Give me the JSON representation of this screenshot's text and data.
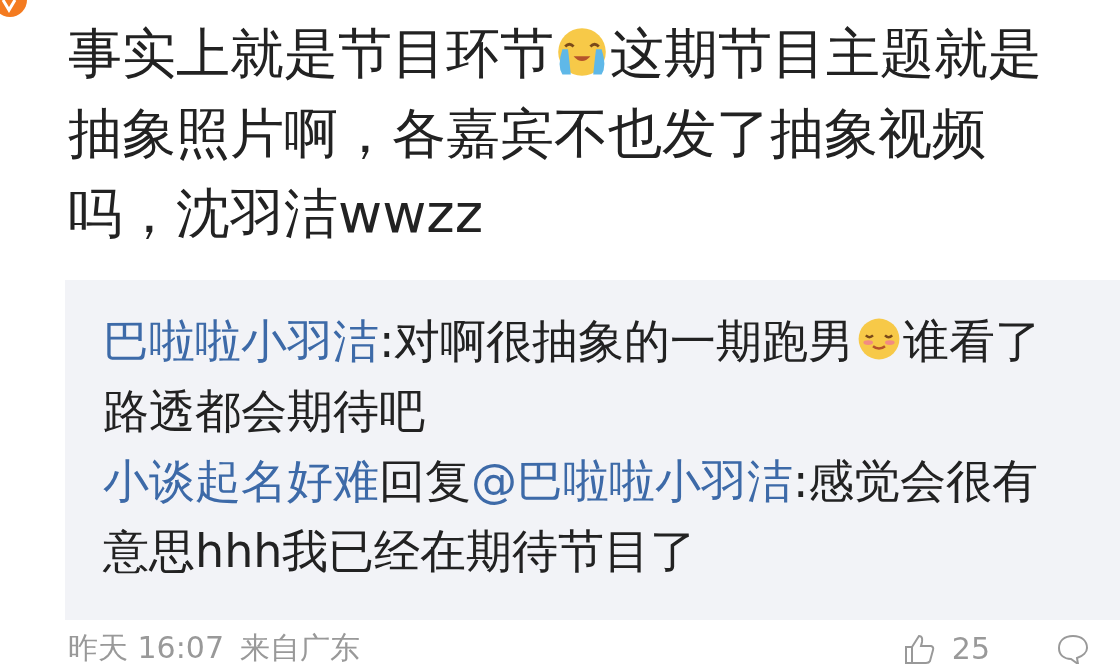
{
  "comment": {
    "body": [
      {
        "kind": "text",
        "text": "事实上就是节目环节"
      },
      {
        "kind": "crying_emoji"
      },
      {
        "kind": "text",
        "text": "这期节目主题就是抽象照片啊，各嘉宾不也发了抽象视频吗，沈羽洁wwzz"
      }
    ]
  },
  "replies": [
    {
      "user": "巴啦啦小羽洁",
      "body": [
        {
          "kind": "text",
          "text": ":对啊很抽象的一期跑男"
        },
        {
          "kind": "smile_emoji"
        },
        {
          "kind": "text",
          "text": "谁看了路透都会期待吧"
        }
      ]
    },
    {
      "user": "小谈起名好难",
      "body": [
        {
          "kind": "text",
          "text": "回复"
        },
        {
          "kind": "mention",
          "text": "@巴啦啦小羽洁"
        },
        {
          "kind": "text",
          "text": ":感觉会很有意思hhh我已经在期待节目了"
        }
      ]
    }
  ],
  "footer": {
    "time": "昨天 16:07",
    "source": "来自广东",
    "likes": "25"
  }
}
